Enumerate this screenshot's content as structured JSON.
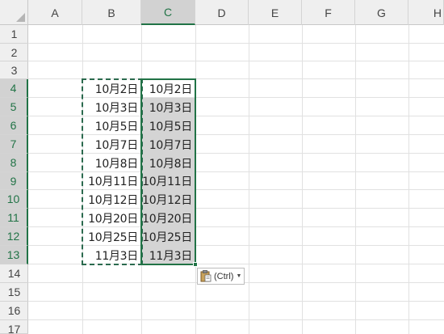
{
  "columns": [
    "A",
    "B",
    "C",
    "D",
    "E",
    "F",
    "G",
    "H"
  ],
  "selected_column": "C",
  "rows": [
    "1",
    "2",
    "3",
    "4",
    "5",
    "6",
    "7",
    "8",
    "9",
    "10",
    "11",
    "12",
    "13",
    "14",
    "15",
    "16",
    "17"
  ],
  "selected_rows": [
    "4",
    "5",
    "6",
    "7",
    "8",
    "9",
    "10",
    "11",
    "12",
    "13"
  ],
  "column_b": [
    "10月2日",
    "10月3日",
    "10月5日",
    "10月7日",
    "10月8日",
    "10月11日",
    "10月12日",
    "10月20日",
    "10月25日",
    "11月3日"
  ],
  "column_c": [
    "10月2日",
    "10月3日",
    "10月5日",
    "10月7日",
    "10月8日",
    "10月11日",
    "10月12日",
    "10月20日",
    "10月25日",
    "11月3日"
  ],
  "paste_options": {
    "label": "(Ctrl)"
  },
  "colors": {
    "accent": "#217346",
    "selection_fill": "#d4d4d4",
    "header_bg": "#efefef"
  }
}
